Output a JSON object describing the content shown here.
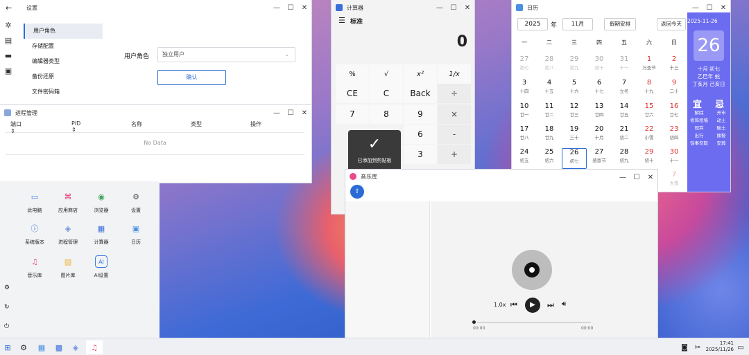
{
  "settings": {
    "back_icon": "←",
    "title": "设置",
    "controls": [
      "—",
      "☐",
      "✕"
    ],
    "nav": [
      "用户角色",
      "存储配置",
      "编辑器类型",
      "备份还原",
      "文件密码箱"
    ],
    "role_label": "用户角色",
    "role_value": "独立用户",
    "confirm": "确认"
  },
  "process": {
    "title": "进程管理",
    "headers": [
      "端口",
      "PID",
      "名称",
      "类型",
      "操作"
    ],
    "empty": "No Data",
    "controls": [
      "—",
      "☐",
      "✕"
    ]
  },
  "launcher": {
    "apps": [
      {
        "label": "此电脑",
        "icon": "computer-icon",
        "color": "#3a7be0"
      },
      {
        "label": "应用商店",
        "icon": "store-icon",
        "color": "#e0306a"
      },
      {
        "label": "浏览器",
        "icon": "browser-icon",
        "color": "#3aa35a"
      },
      {
        "label": "设置",
        "icon": "gear-icon",
        "color": "#555555"
      },
      {
        "label": "系统版本",
        "icon": "info-icon",
        "color": "#2e6fd8"
      },
      {
        "label": "进程管理",
        "icon": "process-icon",
        "color": "#6a8ed8"
      },
      {
        "label": "计算器",
        "icon": "calculator-icon",
        "color": "#3a6fd8"
      },
      {
        "label": "日历",
        "icon": "calendar-icon",
        "color": "#4a90e2"
      },
      {
        "label": "音乐库",
        "icon": "music-icon",
        "color": "#e84a8a"
      },
      {
        "label": "图片库",
        "icon": "picture-icon",
        "color": "#f0b23a"
      },
      {
        "label": "AI设置",
        "icon": "ai-icon",
        "color": "#3a7be0"
      }
    ]
  },
  "calculator": {
    "title": "计算器",
    "mode": "标准",
    "display": "0",
    "keys": [
      "%",
      "√",
      "x²",
      "1/x",
      "CE",
      "C",
      "Back",
      "÷",
      "7",
      "8",
      "9",
      "×",
      "",
      "",
      "6",
      "-",
      "",
      "",
      "3",
      "+"
    ],
    "toast": "已添加到剪贴板",
    "controls": [
      "—",
      "☐",
      "✕"
    ]
  },
  "calendar": {
    "title": "日历",
    "year": "2025",
    "year_unit": "年",
    "month": "11月",
    "holiday": "假期安排",
    "today_btn": "返回今天",
    "weekdays": [
      "一",
      "二",
      "三",
      "四",
      "五",
      "六",
      "日"
    ],
    "date_label": "2025-11-26",
    "big_day": "26",
    "lunar": "十月 初七",
    "ganzhi": "乙巳年 蛇",
    "ganzhi2": "丁亥月 己亥日",
    "yi": "宜",
    "ji": "忌",
    "yi_items": [
      "解除",
      "修饰垣墙",
      "冠笄",
      "出行",
      "馀事勿取"
    ],
    "ji_items": [
      "开市",
      "动土",
      "破土",
      "嫁娶",
      "安葬"
    ],
    "days": [
      {
        "d": "27",
        "l": "初七",
        "c": "dim"
      },
      {
        "d": "28",
        "l": "初八",
        "c": "dim"
      },
      {
        "d": "29",
        "l": "初九",
        "c": "dim"
      },
      {
        "d": "30",
        "l": "初十",
        "c": "dim"
      },
      {
        "d": "31",
        "l": "十一",
        "c": "dim"
      },
      {
        "d": "1",
        "l": "万圣节",
        "c": "red"
      },
      {
        "d": "2",
        "l": "十三",
        "c": "red"
      },
      {
        "d": "3",
        "l": "十四",
        "c": ""
      },
      {
        "d": "4",
        "l": "十五",
        "c": ""
      },
      {
        "d": "5",
        "l": "十六",
        "c": ""
      },
      {
        "d": "6",
        "l": "十七",
        "c": ""
      },
      {
        "d": "7",
        "l": "立冬",
        "c": ""
      },
      {
        "d": "8",
        "l": "十九",
        "c": "red"
      },
      {
        "d": "9",
        "l": "二十",
        "c": "red"
      },
      {
        "d": "10",
        "l": "廿一",
        "c": ""
      },
      {
        "d": "11",
        "l": "廿二",
        "c": ""
      },
      {
        "d": "12",
        "l": "廿三",
        "c": ""
      },
      {
        "d": "13",
        "l": "廿四",
        "c": ""
      },
      {
        "d": "14",
        "l": "廿五",
        "c": ""
      },
      {
        "d": "15",
        "l": "廿六",
        "c": "red"
      },
      {
        "d": "16",
        "l": "廿七",
        "c": "red"
      },
      {
        "d": "17",
        "l": "廿八",
        "c": ""
      },
      {
        "d": "18",
        "l": "廿九",
        "c": ""
      },
      {
        "d": "19",
        "l": "三十",
        "c": ""
      },
      {
        "d": "20",
        "l": "十月",
        "c": ""
      },
      {
        "d": "21",
        "l": "初二",
        "c": ""
      },
      {
        "d": "22",
        "l": "小雪",
        "c": "red"
      },
      {
        "d": "23",
        "l": "初四",
        "c": "red"
      },
      {
        "d": "24",
        "l": "初五",
        "c": ""
      },
      {
        "d": "25",
        "l": "初六",
        "c": ""
      },
      {
        "d": "26",
        "l": "初七",
        "c": "sel"
      },
      {
        "d": "27",
        "l": "感恩节",
        "c": ""
      },
      {
        "d": "28",
        "l": "初九",
        "c": ""
      },
      {
        "d": "29",
        "l": "初十",
        "c": "red"
      },
      {
        "d": "30",
        "l": "十一",
        "c": "red"
      },
      {
        "d": "7",
        "l": "大雪",
        "c": "dimr"
      }
    ]
  },
  "music": {
    "title": "音乐库",
    "speed": "1.0x",
    "time_start": "00:00",
    "time_end": "00:00",
    "controls": [
      "—",
      "☐",
      "✕"
    ]
  },
  "taskbar": {
    "time": "17:41",
    "date": "2025/11/26"
  },
  "colors": {
    "accent": "#2b6bd6",
    "calendar_panel": "#6c6cf0"
  }
}
